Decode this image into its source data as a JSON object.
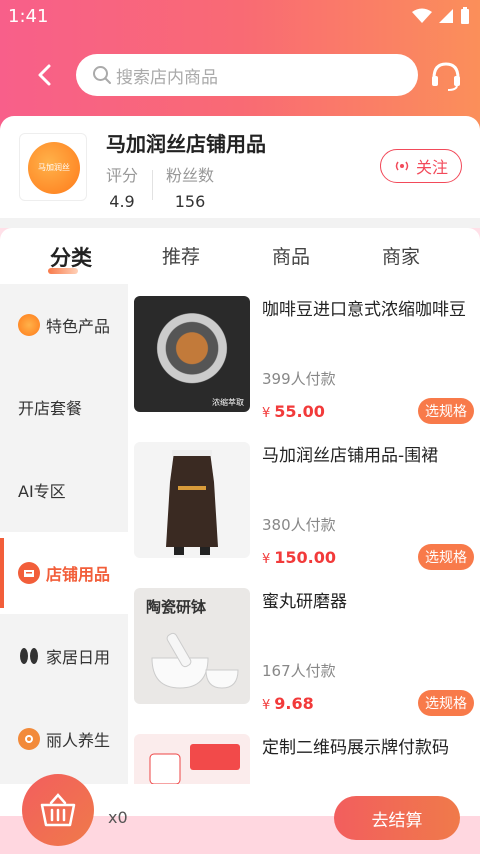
{
  "status_bar": {
    "time": "1:41"
  },
  "header": {
    "search_placeholder": "搜索店内商品"
  },
  "store": {
    "name": "马加润丝店铺用品",
    "rating_label": "评分",
    "rating_value": "4.9",
    "fans_label": "粉丝数",
    "fans_value": "156",
    "follow_label": "关注"
  },
  "tabs": [
    {
      "label": "分类",
      "active": true
    },
    {
      "label": "推荐",
      "active": false
    },
    {
      "label": "商品",
      "active": false
    },
    {
      "label": "商家",
      "active": false
    }
  ],
  "sidebar": [
    {
      "label": "特色产品",
      "icon": "orange-badge-icon",
      "active": false
    },
    {
      "label": "开店套餐",
      "icon": "",
      "active": false
    },
    {
      "label": "AI专区",
      "icon": "",
      "active": false
    },
    {
      "label": "店铺用品",
      "icon": "store-box-icon",
      "active": true
    },
    {
      "label": "家居日用",
      "icon": "slippers-icon",
      "active": false
    },
    {
      "label": "丽人养生",
      "icon": "beauty-icon",
      "active": false
    }
  ],
  "products": [
    {
      "title": "咖啡豆进口意式浓缩咖啡豆",
      "sold": "399人付款",
      "currency": "¥",
      "price": "55.00",
      "spec": "选规格",
      "image_label": "浓缩萃取"
    },
    {
      "title": "马加润丝店铺用品-围裙",
      "sold": "380人付款",
      "currency": "¥",
      "price": "150.00",
      "spec": "选规格"
    },
    {
      "title": "蜜丸研磨器",
      "sold": "167人付款",
      "currency": "¥",
      "price": "9.68",
      "spec": "选规格",
      "image_label": "陶瓷研钵"
    },
    {
      "title": "定制二维码展示牌付款码",
      "sold": "",
      "currency": "",
      "price": "",
      "spec": ""
    }
  ],
  "footer": {
    "cart_count": "x0",
    "checkout_label": "去结算"
  },
  "colors": {
    "header_start": "#f85f8a",
    "header_end": "#fb8f5a",
    "accent": "#f25e3a",
    "price": "#f23a3a"
  }
}
